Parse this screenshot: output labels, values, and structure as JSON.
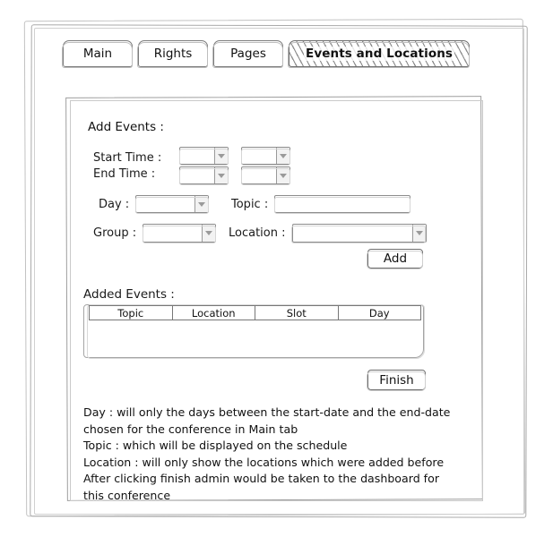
{
  "window": {
    "style": "wireframe-sketch"
  },
  "tabs": [
    {
      "label": "Main",
      "active": false
    },
    {
      "label": "Rights",
      "active": false
    },
    {
      "label": "Pages",
      "active": false
    },
    {
      "label": "Events and Locations",
      "active": true
    }
  ],
  "panel": {
    "add_events_title": "Add Events :",
    "time": {
      "start_label": "Start Time :",
      "end_label": "End Time :",
      "selects": [
        {
          "name": "start-hour",
          "value": ""
        },
        {
          "name": "start-minute",
          "value": ""
        },
        {
          "name": "end-hour",
          "value": ""
        },
        {
          "name": "end-minute",
          "value": ""
        }
      ]
    },
    "fields": {
      "day_label": "Day :",
      "day_value": "",
      "topic_label": "Topic :",
      "topic_value": "",
      "group_label": "Group :",
      "group_value": "",
      "location_label": "Location :",
      "location_value": ""
    },
    "add_button": "Add",
    "added_events_title": "Added Events :",
    "table": {
      "columns": [
        "Topic",
        "Location",
        "Slot",
        "Day"
      ],
      "rows": []
    },
    "finish_button": "Finish",
    "notes": [
      "Day : will only the days between the start-date and the end-date chosen for the conference in Main tab",
      "Topic : which will be displayed on the schedule",
      "Location : will only show the locations which were added before",
      "After clicking finish admin would be taken to the dashboard for this conference"
    ]
  },
  "colors": {
    "ink": "#111111",
    "stroke": "#8c8c8c",
    "hatch": "#8d8d8d",
    "background": "#ffffff"
  }
}
